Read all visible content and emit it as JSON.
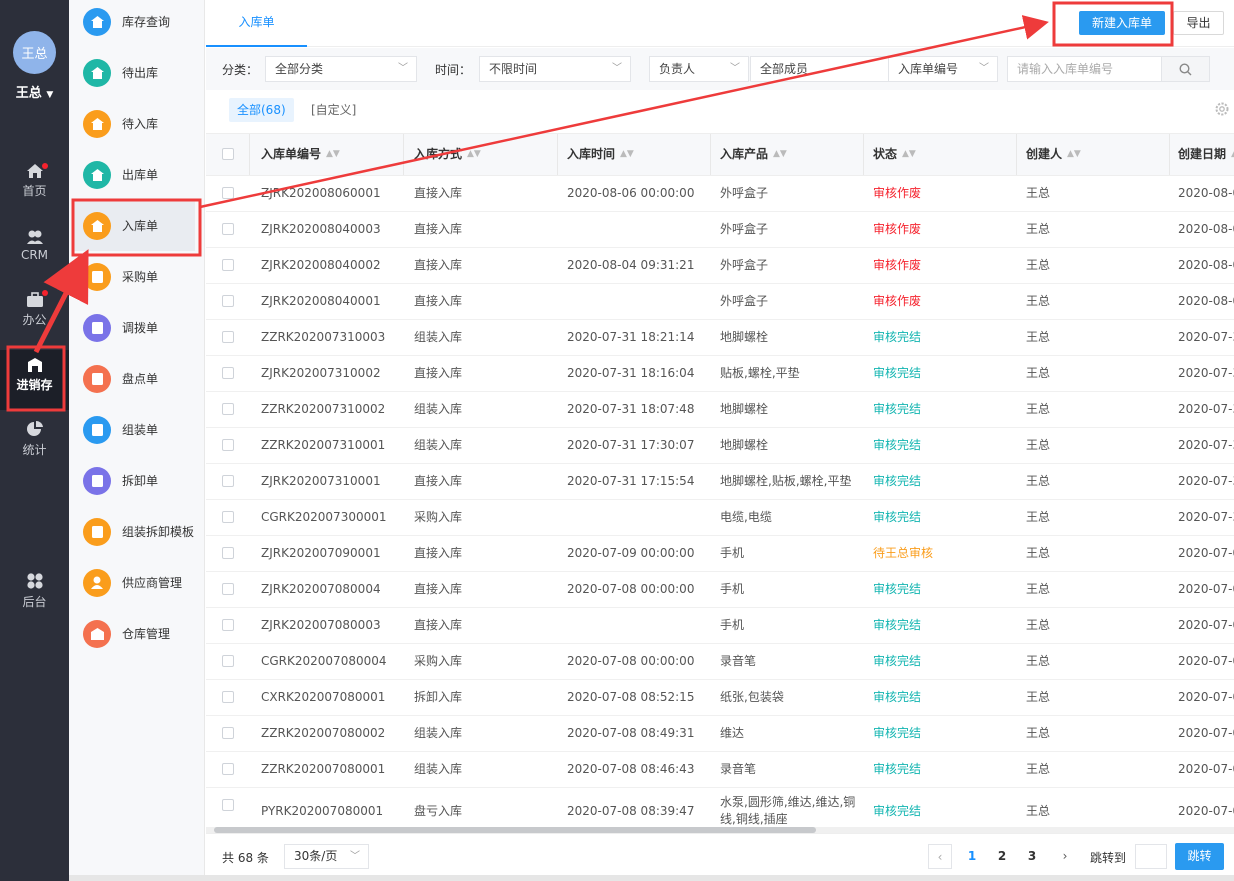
{
  "user": {
    "avatar_text": "王总",
    "name": "王总"
  },
  "rail": {
    "home": "首页",
    "crm": "CRM",
    "office": "办公",
    "inventory": "进销存",
    "stats": "统计",
    "backend": "后台"
  },
  "submenu": [
    "库存查询",
    "待出库",
    "待入库",
    "出库单",
    "入库单",
    "采购单",
    "调拨单",
    "盘点单",
    "组装单",
    "拆卸单",
    "组装拆卸模板",
    "供应商管理",
    "仓库管理"
  ],
  "tab": "入库单",
  "actions": {
    "new": "新建入库单",
    "export": "导出"
  },
  "filters": {
    "category_label": "分类：",
    "category_value": "全部分类",
    "time_label": "时间：",
    "time_value": "不限时间",
    "owner_value": "负责人",
    "members_value": "全部成员",
    "field_value": "入库单编号",
    "search_placeholder": "请输入入库单编号"
  },
  "segments": {
    "all": "全部(68)",
    "custom": "[自定义]"
  },
  "columns": [
    "入库单编号",
    "入库方式",
    "入库时间",
    "入库产品",
    "状态",
    "创建人",
    "创建日期"
  ],
  "rows": [
    [
      "ZJRK202008060001",
      "直接入库",
      "2020-08-06 00:00:00",
      "外呼盒子",
      "审核作废",
      "王总",
      "2020-08-0"
    ],
    [
      "ZJRK202008040003",
      "直接入库",
      "",
      "外呼盒子",
      "审核作废",
      "王总",
      "2020-08-0"
    ],
    [
      "ZJRK202008040002",
      "直接入库",
      "2020-08-04 09:31:21",
      "外呼盒子",
      "审核作废",
      "王总",
      "2020-08-0"
    ],
    [
      "ZJRK202008040001",
      "直接入库",
      "",
      "外呼盒子",
      "审核作废",
      "王总",
      "2020-08-0"
    ],
    [
      "ZZRK202007310003",
      "组装入库",
      "2020-07-31 18:21:14",
      "地脚螺栓",
      "审核完结",
      "王总",
      "2020-07-3"
    ],
    [
      "ZJRK202007310002",
      "直接入库",
      "2020-07-31 18:16:04",
      "贴板,螺栓,平垫",
      "审核完结",
      "王总",
      "2020-07-3"
    ],
    [
      "ZZRK202007310002",
      "组装入库",
      "2020-07-31 18:07:48",
      "地脚螺栓",
      "审核完结",
      "王总",
      "2020-07-3"
    ],
    [
      "ZZRK202007310001",
      "组装入库",
      "2020-07-31 17:30:07",
      "地脚螺栓",
      "审核完结",
      "王总",
      "2020-07-3"
    ],
    [
      "ZJRK202007310001",
      "直接入库",
      "2020-07-31 17:15:54",
      "地脚螺栓,贴板,螺栓,平垫",
      "审核完结",
      "王总",
      "2020-07-3"
    ],
    [
      "CGRK202007300001",
      "采购入库",
      "",
      "电缆,电缆",
      "审核完结",
      "王总",
      "2020-07-3"
    ],
    [
      "ZJRK202007090001",
      "直接入库",
      "2020-07-09 00:00:00",
      "手机",
      "待王总审核",
      "王总",
      "2020-07-0"
    ],
    [
      "ZJRK202007080004",
      "直接入库",
      "2020-07-08 00:00:00",
      "手机",
      "审核完结",
      "王总",
      "2020-07-0"
    ],
    [
      "ZJRK202007080003",
      "直接入库",
      "",
      "手机",
      "审核完结",
      "王总",
      "2020-07-0"
    ],
    [
      "CGRK202007080004",
      "采购入库",
      "2020-07-08 00:00:00",
      "录音笔",
      "审核完结",
      "王总",
      "2020-07-0"
    ],
    [
      "CXRK202007080001",
      "拆卸入库",
      "2020-07-08 08:52:15",
      "纸张,包装袋",
      "审核完结",
      "王总",
      "2020-07-0"
    ],
    [
      "ZZRK202007080002",
      "组装入库",
      "2020-07-08 08:49:31",
      "维达",
      "审核完结",
      "王总",
      "2020-07-0"
    ],
    [
      "ZZRK202007080001",
      "组装入库",
      "2020-07-08 08:46:43",
      "录音笔",
      "审核完结",
      "王总",
      "2020-07-0"
    ],
    [
      "PYRK202007080001",
      "盘亏入库",
      "2020-07-08 08:39:47",
      "水泵,圆形筛,维达,维达,铜线,铜线,插座",
      "审核完结",
      "王总",
      "2020-07-0"
    ]
  ],
  "status_colors": {
    "审核作废": "#f5222d",
    "审核完结": "#13b5b1",
    "待王总审核": "#fa9d1c"
  },
  "footer": {
    "total": "共 68 条",
    "page_size": "30条/页",
    "pages": [
      "1",
      "2",
      "3"
    ],
    "current_page": "1",
    "jump_label": "跳转到",
    "go": "跳转"
  },
  "colors": {
    "accent": "#2a9af0",
    "annotation": "#ee3b3b",
    "rail_bg": "#2c2f3a"
  }
}
